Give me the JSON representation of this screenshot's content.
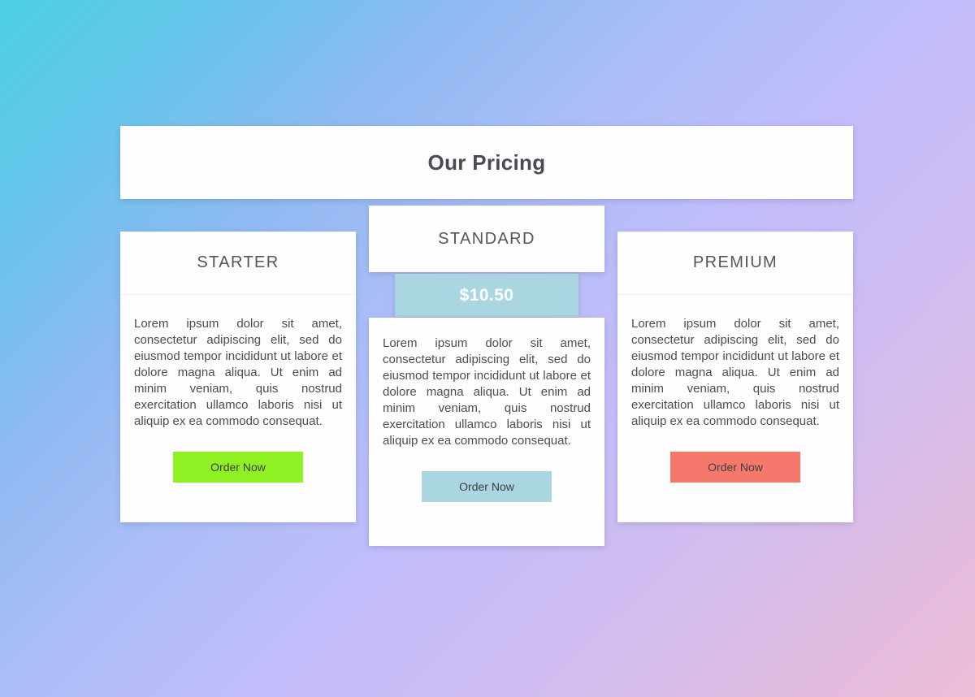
{
  "header": {
    "title": "Our Pricing"
  },
  "plans": [
    {
      "name": "STARTER",
      "price": "",
      "description": "Lorem ipsum dolor sit amet, consectetur adipiscing elit, sed do eiusmod tempor incididunt ut labore et dolore magna aliqua. Ut enim ad minim veniam, quis nostrud exercitation ullamco laboris nisi ut aliquip ex ea commodo consequat.",
      "button_label": "Order Now",
      "button_color": "#8ff023",
      "button_text_color": "#3e3e44"
    },
    {
      "name": "STANDARD",
      "price": "$10.50",
      "description": "Lorem ipsum dolor sit amet, consectetur adipiscing elit, sed do eiusmod tempor incididunt ut labore et dolore magna aliqua. Ut enim ad minim veniam, quis nostrud exercitation ullamco laboris nisi ut aliquip ex ea commodo consequat.",
      "button_label": "Order Now",
      "button_color": "#a9d6e0",
      "button_text_color": "#3e3e44",
      "price_band_color": "#a9d6e0",
      "price_text_color": "#ffffff"
    },
    {
      "name": "PREMIUM",
      "price": "",
      "description": "Lorem ipsum dolor sit amet, consectetur adipiscing elit, sed do eiusmod tempor incididunt ut labore et dolore magna aliqua. Ut enim ad minim veniam, quis nostrud exercitation ullamco laboris nisi ut aliquip ex ea commodo consequat.",
      "button_label": "Order Now",
      "button_color": "#f4786c",
      "button_text_color": "#3e3e44"
    }
  ],
  "theme": {
    "card_background": "#fdfdfd",
    "title_color": "#4a4a55",
    "body_text_color": "#4c4c52",
    "gradient_top_left": "#4cd0e3",
    "gradient_top_right": "#c0bdfa",
    "gradient_bottom_left": "#9dc3f0",
    "gradient_bottom_right": "#ecbdd6"
  }
}
